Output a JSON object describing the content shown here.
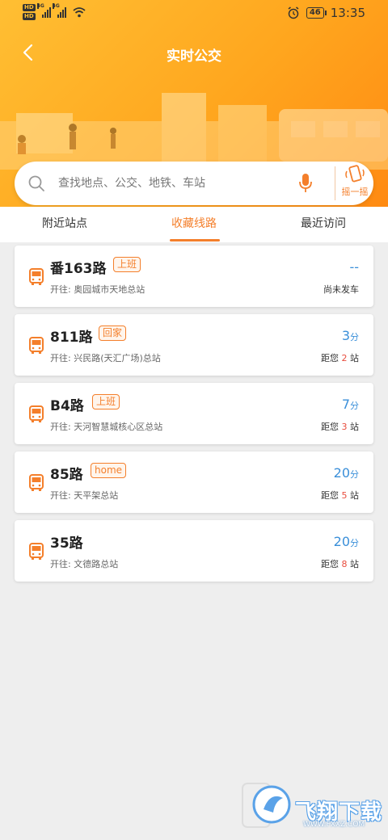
{
  "status_bar": {
    "hd1": "HD",
    "hd2": "HD",
    "net1": "4G",
    "net2": "4G",
    "battery": "46",
    "time": "13:35"
  },
  "header": {
    "title": "实时公交"
  },
  "search": {
    "placeholder": "查找地点、公交、地铁、车站",
    "shake_label": "摇一摇"
  },
  "tabs": [
    {
      "label": "附近站点",
      "active": false
    },
    {
      "label": "收藏线路",
      "active": true
    },
    {
      "label": "最近访问",
      "active": false
    }
  ],
  "routes": [
    {
      "name": "番163路",
      "tag": "上班",
      "dest": "开往: 奥园城市天地总站",
      "arrival": "--",
      "arrival_unit": "",
      "distance_text": "尚未发车"
    },
    {
      "name": "811路",
      "tag": "回家",
      "dest": "开往: 兴民路(天汇广场)总站",
      "arrival": "3",
      "arrival_unit": "分",
      "distance_prefix": "距您 ",
      "stops": "2",
      "distance_suffix": " 站"
    },
    {
      "name": "B4路",
      "tag": "上班",
      "dest": "开往: 天河智慧城核心区总站",
      "arrival": "7",
      "arrival_unit": "分",
      "distance_prefix": "距您 ",
      "stops": "3",
      "distance_suffix": " 站"
    },
    {
      "name": "85路",
      "tag": "home",
      "dest": "开往: 天平架总站",
      "arrival": "20",
      "arrival_unit": "分",
      "distance_prefix": "距您 ",
      "stops": "5",
      "distance_suffix": " 站"
    },
    {
      "name": "35路",
      "tag": "",
      "dest": "开往: 文德路总站",
      "arrival": "20",
      "arrival_unit": "分",
      "distance_prefix": "距您 ",
      "stops": "8",
      "distance_suffix": " 站"
    }
  ],
  "watermark": {
    "text": "飞翔下载",
    "url": "WWW.FXXZ.COM"
  },
  "colors": {
    "accent": "#f47f2b",
    "arrival": "#3a8fd9",
    "stops": "#e84c3d"
  }
}
